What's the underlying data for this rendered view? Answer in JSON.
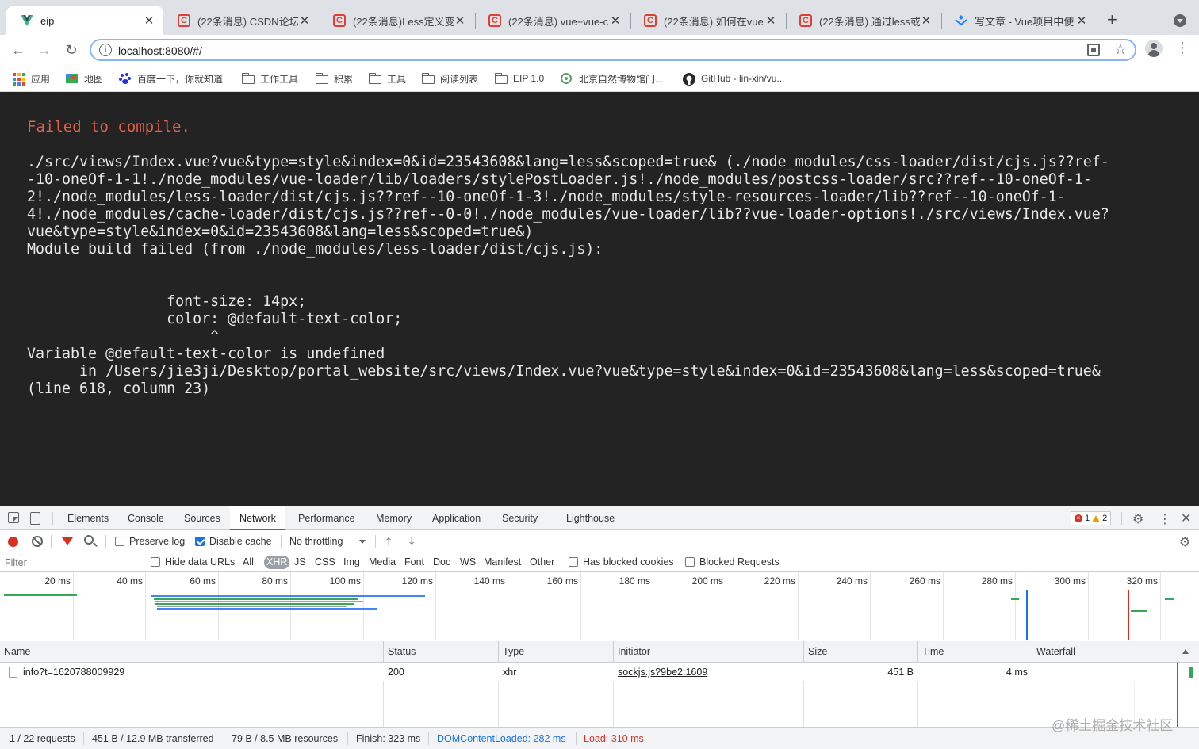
{
  "tabs": [
    {
      "title": "eip",
      "favicon": "vue-logo",
      "active": true
    },
    {
      "title": "(22条消息) CSDN论坛",
      "favicon": "csdn-c"
    },
    {
      "title": "(22条消息)Less定义变",
      "favicon": "csdn-c"
    },
    {
      "title": "(22条消息) vue+vue-c",
      "favicon": "csdn-c"
    },
    {
      "title": "(22条消息) 如何在vue",
      "favicon": "csdn-c"
    },
    {
      "title": "(22条消息) 通过less或",
      "favicon": "csdn-c"
    },
    {
      "title": "写文章 - Vue项目中使",
      "favicon": "juejin-logo"
    }
  ],
  "toolbar": {
    "close_glyph": "✕",
    "newtab_glyph": "+",
    "back_glyph": "←",
    "forward_glyph": "→",
    "reload_glyph": "↻",
    "url": "localhost:8080/#/",
    "info_glyph": "i",
    "star_glyph": "☆",
    "menu_glyph": "⋮"
  },
  "bookmarks": [
    {
      "label": "应用",
      "icon": "apps-grid-icon"
    },
    {
      "label": "地图",
      "icon": "maps-icon"
    },
    {
      "label": "百度一下，你就知道",
      "icon": "baidu-icon"
    },
    {
      "label": "工作工具",
      "icon": "folder-icon"
    },
    {
      "label": "积累",
      "icon": "folder-icon"
    },
    {
      "label": "工具",
      "icon": "folder-icon"
    },
    {
      "label": "阅读列表",
      "icon": "folder-icon"
    },
    {
      "label": "EIP 1.0",
      "icon": "folder-icon"
    },
    {
      "label": "北京自然博物馆门...",
      "icon": "museum-icon"
    },
    {
      "label": "GitHub - lin-xin/vu...",
      "icon": "github-icon"
    }
  ],
  "error": {
    "title": "Failed to compile.",
    "body": "./src/views/Index.vue?vue&type=style&index=0&id=23543608&lang=less&scoped=true& (./node_modules/css-loader/dist/cjs.js??ref-\n-10-oneOf-1-1!./node_modules/vue-loader/lib/loaders/stylePostLoader.js!./node_modules/postcss-loader/src??ref--10-oneOf-1-\n2!./node_modules/less-loader/dist/cjs.js??ref--10-oneOf-1-3!./node_modules/style-resources-loader/lib??ref--10-oneOf-1-\n4!./node_modules/cache-loader/dist/cjs.js??ref--0-0!./node_modules/vue-loader/lib??vue-loader-options!./src/views/Index.vue?\nvue&type=style&index=0&id=23543608&lang=less&scoped=true&)\nModule build failed (from ./node_modules/less-loader/dist/cjs.js):\n\n\n                font-size: 14px;\n                color: @default-text-color;\n                     ^\nVariable @default-text-color is undefined\n      in /Users/jie3ji/Desktop/portal_website/src/views/Index.vue?vue&type=style&index=0&id=23543608&lang=less&scoped=true&\n(line 618, column 23)"
  },
  "devtools": {
    "tabs": [
      "Elements",
      "Console",
      "Sources",
      "Network",
      "Performance",
      "Memory",
      "Application",
      "Security",
      "Lighthouse"
    ],
    "active_tab": "Network",
    "error_count": "1",
    "warning_count": "2",
    "gear_glyph": "⚙",
    "more_glyph": "⋮",
    "close_glyph": "✕",
    "network": {
      "preserve_log": "Preserve log",
      "disable_cache": "Disable cache",
      "disable_cache_checked": true,
      "throttling": "No throttling",
      "upload_glyph": "⤒",
      "download_glyph": "⤓",
      "filter_placeholder": "Filter",
      "hide_data_urls": "Hide data URLs",
      "filter_types": [
        "All",
        "XHR",
        "JS",
        "CSS",
        "Img",
        "Media",
        "Font",
        "Doc",
        "WS",
        "Manifest",
        "Other"
      ],
      "selected_type": "XHR",
      "has_blocked_cookies": "Has blocked cookies",
      "blocked_requests": "Blocked Requests",
      "overview_ticks": [
        "20 ms",
        "40 ms",
        "60 ms",
        "80 ms",
        "100 ms",
        "120 ms",
        "140 ms",
        "160 ms",
        "180 ms",
        "200 ms",
        "220 ms",
        "240 ms",
        "260 ms",
        "280 ms",
        "300 ms",
        "320 ms"
      ],
      "columns": [
        "Name",
        "Status",
        "Type",
        "Initiator",
        "Size",
        "Time",
        "Waterfall"
      ],
      "rows": [
        {
          "name": "info?t=1620788009929",
          "status": "200",
          "type": "xhr",
          "initiator": "sockjs.js?9be2:1609",
          "size": "451 B",
          "time": "4 ms"
        }
      ],
      "status_bar": {
        "requests": "1 / 22 requests",
        "transferred": "451 B / 12.9 MB transferred",
        "resources": "79 B / 8.5 MB resources",
        "finish": "Finish: 323 ms",
        "dom_content_loaded": "DOMContentLoaded: 282 ms",
        "load": "Load: 310 ms"
      }
    }
  },
  "watermark": "@稀土掘金技术社区",
  "colors": {
    "accent": "#1a73e8",
    "error_red": "#d93025",
    "compile_error": "#e36049",
    "dcl_blue": "#1a73e8",
    "load_red": "#d93025"
  }
}
